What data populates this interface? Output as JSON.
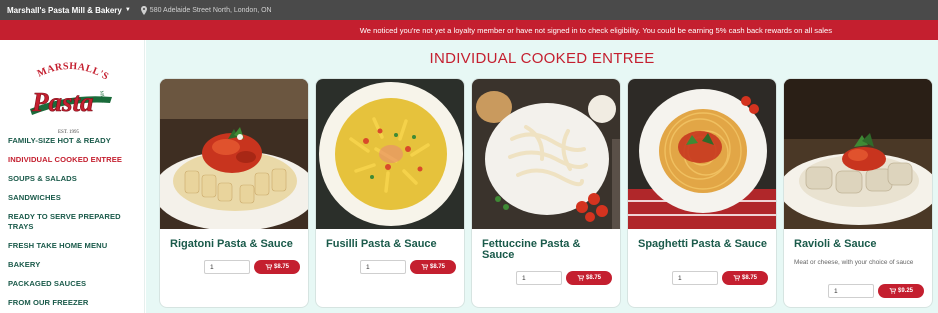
{
  "header": {
    "store_name": "Marshall's Pasta Mill & Bakery",
    "address": "580 Adelaide Street North, London, ON"
  },
  "banner": {
    "text": "We noticed you're not yet a loyalty member or have not signed in to check eligibility. You could be earning 5% cash back rewards on all sales"
  },
  "logo": {
    "brand": "MARSHALL'S",
    "word": "Pasta",
    "sub": "MILL",
    "est": "EST. 1995"
  },
  "sidebar": {
    "items": [
      {
        "label": "FAMILY-SIZE HOT & READY"
      },
      {
        "label": "INDIVIDUAL COOKED ENTREE",
        "active": true
      },
      {
        "label": "SOUPS & SALADS"
      },
      {
        "label": "SANDWICHES"
      },
      {
        "label": "READY TO SERVE PREPARED TRAYS"
      },
      {
        "label": "FRESH TAKE HOME MENU"
      },
      {
        "label": "BAKERY"
      },
      {
        "label": "PACKAGED SAUCES"
      },
      {
        "label": "FROM OUR FREEZER"
      }
    ]
  },
  "main": {
    "title": "INDIVIDUAL COOKED ENTREE",
    "products": [
      {
        "name": "Rigatoni Pasta & Sauce",
        "description": "",
        "qty": "1",
        "price": "$8.75"
      },
      {
        "name": "Fusilli Pasta & Sauce",
        "description": "",
        "qty": "1",
        "price": "$8.75"
      },
      {
        "name": "Fettuccine Pasta & Sauce",
        "description": "",
        "qty": "1",
        "price": "$8.75"
      },
      {
        "name": "Spaghetti Pasta & Sauce",
        "description": "",
        "qty": "1",
        "price": "$8.75"
      },
      {
        "name": "Ravioli & Sauce",
        "description": "Meat or cheese, with your choice of sauce",
        "qty": "1",
        "price": "$9.25"
      }
    ]
  },
  "colors": {
    "brand_red": "#c41f2f",
    "brand_green": "#1a5a4a",
    "content_bg": "#e7f8f5",
    "topbar": "#4a4a4a"
  }
}
